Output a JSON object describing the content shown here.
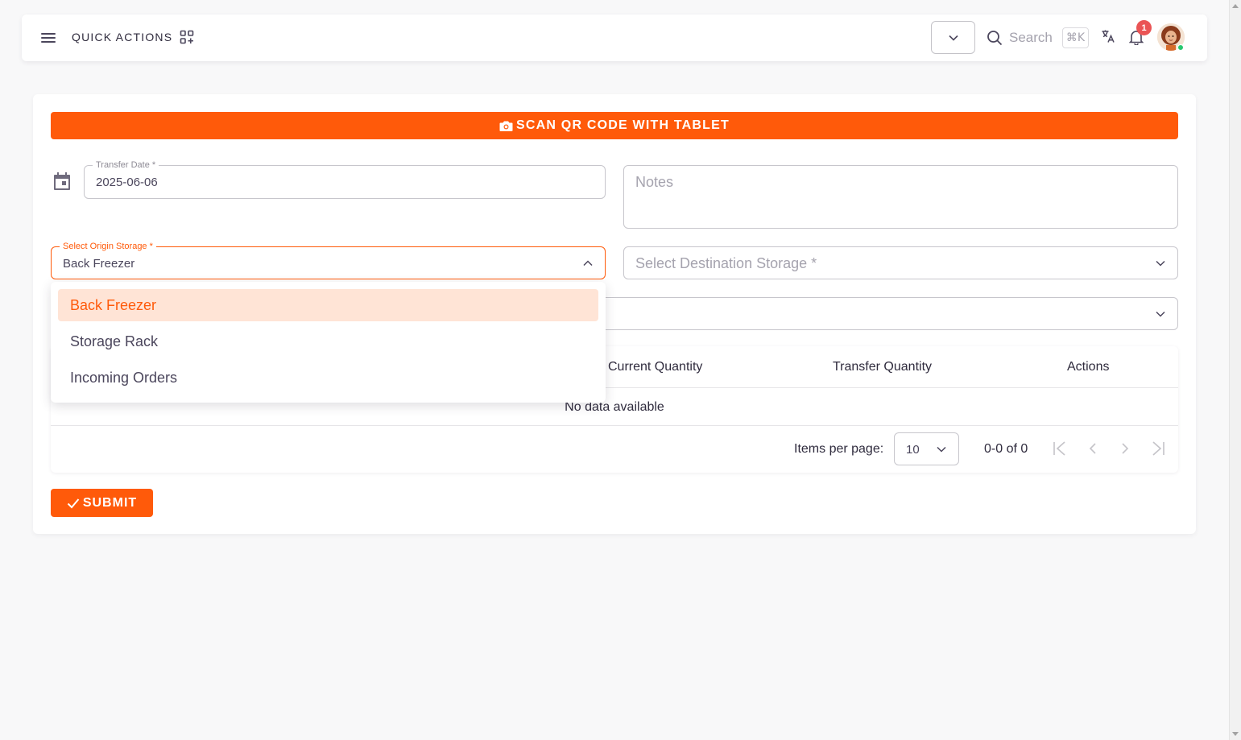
{
  "navbar": {
    "quick_actions_label": "QUICK ACTIONS",
    "search_label": "Search",
    "search_shortcut": "⌘K",
    "notification_count": "1"
  },
  "actions": {
    "scan_label": "SCAN QR CODE WITH TABLET",
    "submit_label": "SUBMIT"
  },
  "form": {
    "transfer_date_label": "Transfer Date *",
    "transfer_date_value": "2025-06-06",
    "notes_placeholder": "Notes",
    "origin_label": "Select Origin Storage *",
    "origin_value": "Back Freezer",
    "destination_placeholder": "Select Destination Storage *"
  },
  "origin_dropdown": {
    "options": [
      "Back Freezer",
      "Storage Rack",
      "Incoming Orders"
    ],
    "selected": "Back Freezer"
  },
  "table": {
    "columns": [
      "Current Quantity",
      "Transfer Quantity",
      "Actions"
    ],
    "empty_text": "No data available",
    "items_per_page_label": "Items per page:",
    "items_per_page_value": "10",
    "range_text": "0-0 of 0"
  },
  "colors": {
    "accent": "#ff5a0a",
    "selected_option_bg": "#ffe4d6",
    "badge": "#ea5455"
  }
}
